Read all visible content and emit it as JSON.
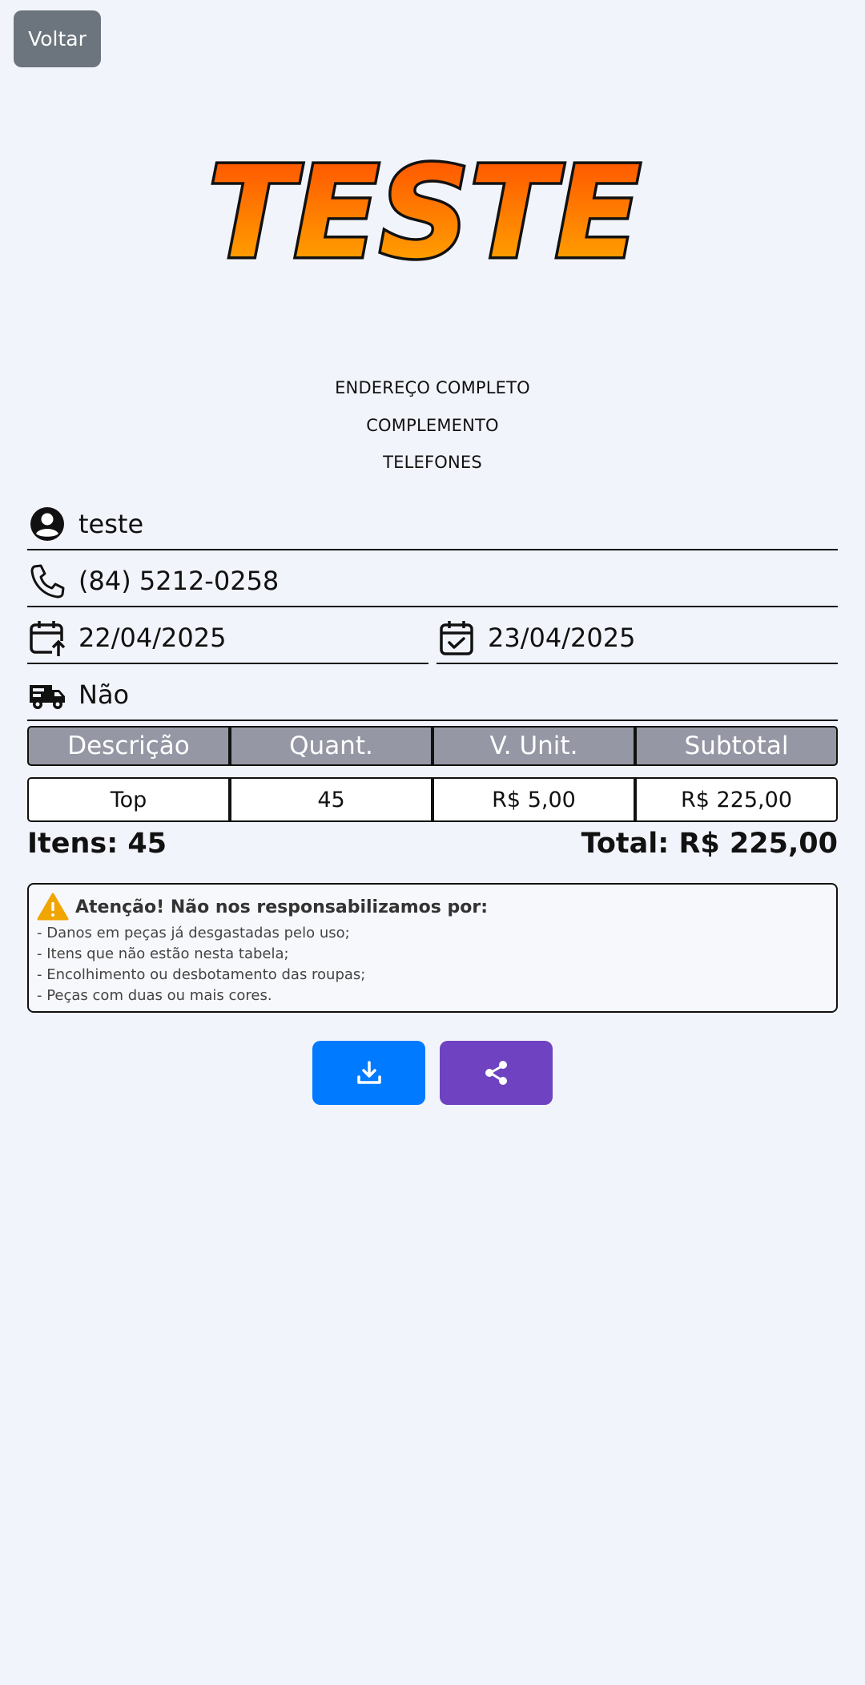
{
  "back_button": {
    "label": "Voltar"
  },
  "logo": {
    "text": "TESTE"
  },
  "address": {
    "line1": "ENDEREÇO COMPLETO",
    "line2": "COMPLEMENTO",
    "line3": "TELEFONES"
  },
  "customer": {
    "name": "teste",
    "phone": "(84) 5212-0258",
    "date_in": "22/04/2025",
    "date_out": "23/04/2025",
    "delivery": "Não",
    "icons": [
      "user-icon",
      "phone-icon",
      "calendar-arrow-up-icon",
      "calendar-check-icon",
      "truck-icon"
    ]
  },
  "table": {
    "headers": [
      "Descrição",
      "Quant.",
      "V. Unit.",
      "Subtotal"
    ],
    "rows": [
      [
        "Top",
        "45",
        "R$ 5,00",
        "R$ 225,00"
      ]
    ]
  },
  "summary": {
    "items": "Itens: 45",
    "total": "Total: R$ 225,00"
  },
  "notice": {
    "title": "Atenção! Não nos responsabilizamos por:",
    "lines": [
      "- Danos em peças já desgastadas pelo uso;",
      "- Itens que não estão nesta tabela;",
      "- Encolhimento ou desbotamento das roupas;",
      "- Peças com duas ou mais cores."
    ]
  },
  "actions": {
    "download_icon": "download-icon",
    "share_icon": "share-icon"
  },
  "colors": {
    "background": "#f2f4fb",
    "back_button": "#6c757d",
    "table_header": "#9597a4",
    "download_button": "#007bff",
    "share_button": "#6f42c1",
    "warning": "#f0a500",
    "logo_top": "#ff4a00",
    "logo_bottom": "#ffb000"
  }
}
